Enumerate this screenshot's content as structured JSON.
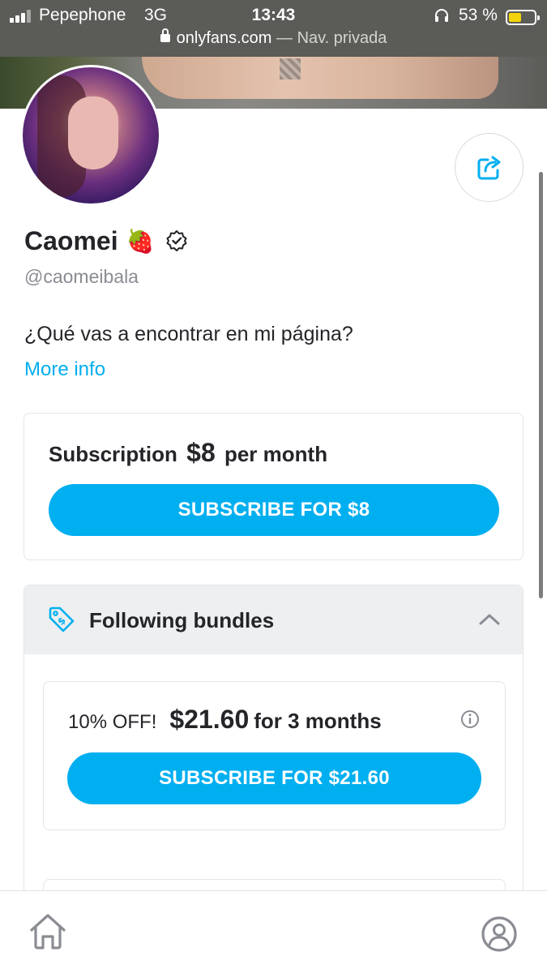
{
  "status_bar": {
    "carrier": "Pepephone",
    "network": "3G",
    "time": "13:43",
    "battery_percent": "53 %",
    "battery_level": 0.53,
    "signal_icon": "signal-bars-icon",
    "headphones_icon": "headphones-icon"
  },
  "url_bar": {
    "domain": "onlyfans.com",
    "mode": " — Nav. privada",
    "lock_icon": "lock-icon"
  },
  "profile": {
    "name": "Caomei",
    "name_emoji": "🍓",
    "verified_icon": "verified-badge-icon",
    "handle": "@caomeibala",
    "about": "¿Qué vas a encontrar en mi página?",
    "more_info_label": "More info",
    "share_icon": "share-icon"
  },
  "subscription": {
    "prefix": "Subscription",
    "price": "$8",
    "suffix": "per month",
    "button_label": "SUBSCRIBE FOR $8"
  },
  "bundles": {
    "title": "Following bundles",
    "tag_icon": "price-tag-icon",
    "toggle_icon": "chevron-up-icon",
    "items": [
      {
        "discount": "10% OFF!",
        "price": "$21.60",
        "period": "for 3 months",
        "button_label": "SUBSCRIBE FOR $21.60",
        "info_icon": "info-icon"
      }
    ]
  },
  "bottom_nav": {
    "home_icon": "home-icon",
    "profile_icon": "profile-icon"
  },
  "colors": {
    "accent": "#00aff0",
    "text": "#242529",
    "muted": "#8a8c93",
    "status_bar_bg": "#5b5b57"
  }
}
